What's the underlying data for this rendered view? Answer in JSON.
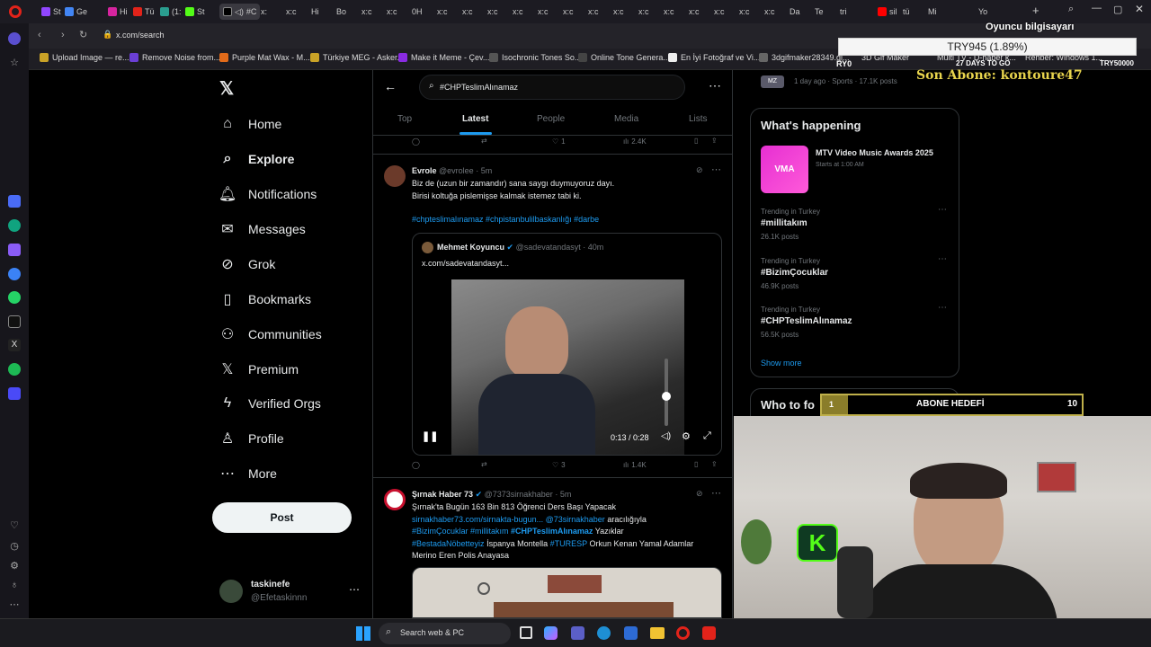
{
  "browser": {
    "tabs": [
      "St",
      "Ge",
      "Hi",
      "Tü",
      "(1:",
      "St",
      "#C",
      "x:",
      "x:c",
      "Hi",
      "Bo",
      "x:c",
      "x:c",
      "0H",
      "x:c",
      "x:c",
      "x:c",
      "x:c",
      "x:c",
      "x:c",
      "x:c",
      "x:c",
      "x:c",
      "x:c",
      "x:c",
      "x:c",
      "x:c",
      "x:c",
      "Da",
      "Te",
      "tri",
      "sil",
      "tü",
      "Mi",
      "Yo"
    ],
    "url": "x.com/search",
    "bookmarks": [
      "Upload Image — re...",
      "Remove Noise from...",
      "Purple Mat Wax - M...",
      "Türkiye MEG - Asker...",
      "Make it Meme - Çev...",
      "Isochronic Tones So...",
      "Online Tone Genera...",
      "En İyi Fotoğraf ve Vi...",
      "3dgifmaker28349.gi...",
      "3D Gif Maker",
      "Multi TV - D-haber k...",
      "Rehber: Windows 1..."
    ]
  },
  "stream_overlay": {
    "target_title": "Oyuncu bilgisayarı",
    "amount": "TRY945 (1.89%)",
    "left_label": "RY0",
    "days_left": "27 DAYS TO GO",
    "goal": "TRY50000",
    "last_sub": "Son Abone: kontoure47",
    "sub_goal_label": "ABONE HEDEFİ",
    "sub_goal_current": "1",
    "sub_goal_target": "10"
  },
  "nav": {
    "items": [
      {
        "label": "Home",
        "icon": "home-icon"
      },
      {
        "label": "Explore",
        "icon": "search-icon"
      },
      {
        "label": "Notifications",
        "icon": "bell-icon"
      },
      {
        "label": "Messages",
        "icon": "envelope-icon"
      },
      {
        "label": "Grok",
        "icon": "grok-icon"
      },
      {
        "label": "Bookmarks",
        "icon": "bookmark-icon"
      },
      {
        "label": "Communities",
        "icon": "people-icon"
      },
      {
        "label": "Premium",
        "icon": "x-icon"
      },
      {
        "label": "Verified Orgs",
        "icon": "lightning-icon"
      },
      {
        "label": "Profile",
        "icon": "person-icon"
      },
      {
        "label": "More",
        "icon": "more-circle-icon"
      }
    ],
    "post_label": "Post",
    "account": {
      "name": "taskinefe",
      "handle": "@Efetaskinnn"
    }
  },
  "search": {
    "query": "#CHPTeslimAlınamaz",
    "tabs": [
      "Top",
      "Latest",
      "People",
      "Media",
      "Lists"
    ],
    "active_tab": "Latest"
  },
  "prev_tweet_actions": {
    "likes": "1",
    "views": "2.4K"
  },
  "tweet1": {
    "name": "Evrole",
    "handle": "@evrolee",
    "time": "· 5m",
    "line1": "Biz de (uzun bir zamandır) sana saygı duymuyoruz dayı.",
    "line2": "Birisi koltuğa pislemişse kalmak istemez tabi ki.",
    "hashtags": "#chpteslimalınamaz #chpistanbulilbaskanlığı #darbe",
    "quote": {
      "name": "Mehmet Koyuncu",
      "handle": "@sadevatandasyt",
      "time": "· 40m",
      "text": "x.com/sadevatandasyt..."
    },
    "video_time": "0:13 / 0:28",
    "likes": "3",
    "views": "1.4K"
  },
  "tweet2": {
    "name": "Şırnak Haber 73",
    "handle": "@7373sirnakhaber",
    "time": "· 5m",
    "line1": "Şırnak'ta Bugün 163 Bin 813 Öğrenci Ders Başı Yapacak",
    "link": "sirnakhaber73.com/sirnakta-bugun...",
    "mention": "@73sirnakhaber",
    "via": "aracılığıyla",
    "tags_a": "#BizimÇocuklar #millitakım",
    "tag_bold": "#CHPTeslimAlınamaz",
    "after_bold": "Yazıklar",
    "tag_b": "#BestadaNöbetteyiz",
    "mid_text": "İspanya Montella",
    "tag_c": "#TURESP",
    "end_text": "Orkun Kenan Yamal Adamlar",
    "line_last": "Merino Eren Polis Anayasa"
  },
  "right": {
    "top_item_meta": "1 day ago · Sports · 17.1K posts",
    "happening_title": "What's happening",
    "event_title": "MTV Video Music Awards 2025",
    "event_time": "Starts at 1:00 AM",
    "trends": [
      {
        "category": "Trending in Turkey",
        "title": "#millitakım",
        "posts": "26.1K posts"
      },
      {
        "category": "Trending in Turkey",
        "title": "#BizimÇocuklar",
        "posts": "46.9K posts"
      },
      {
        "category": "Trending in Turkey",
        "title": "#CHPTeslimAlınamaz",
        "posts": "56.5K posts"
      }
    ],
    "show_more": "Show more",
    "who_to_follow": "Who to fo"
  },
  "taskbar": {
    "search_placeholder": "Search web & PC"
  },
  "colors": {
    "accent": "#1d9bf0",
    "bg": "#000000",
    "border": "#2f3336",
    "overlay_yellow": "#e8d44d"
  }
}
